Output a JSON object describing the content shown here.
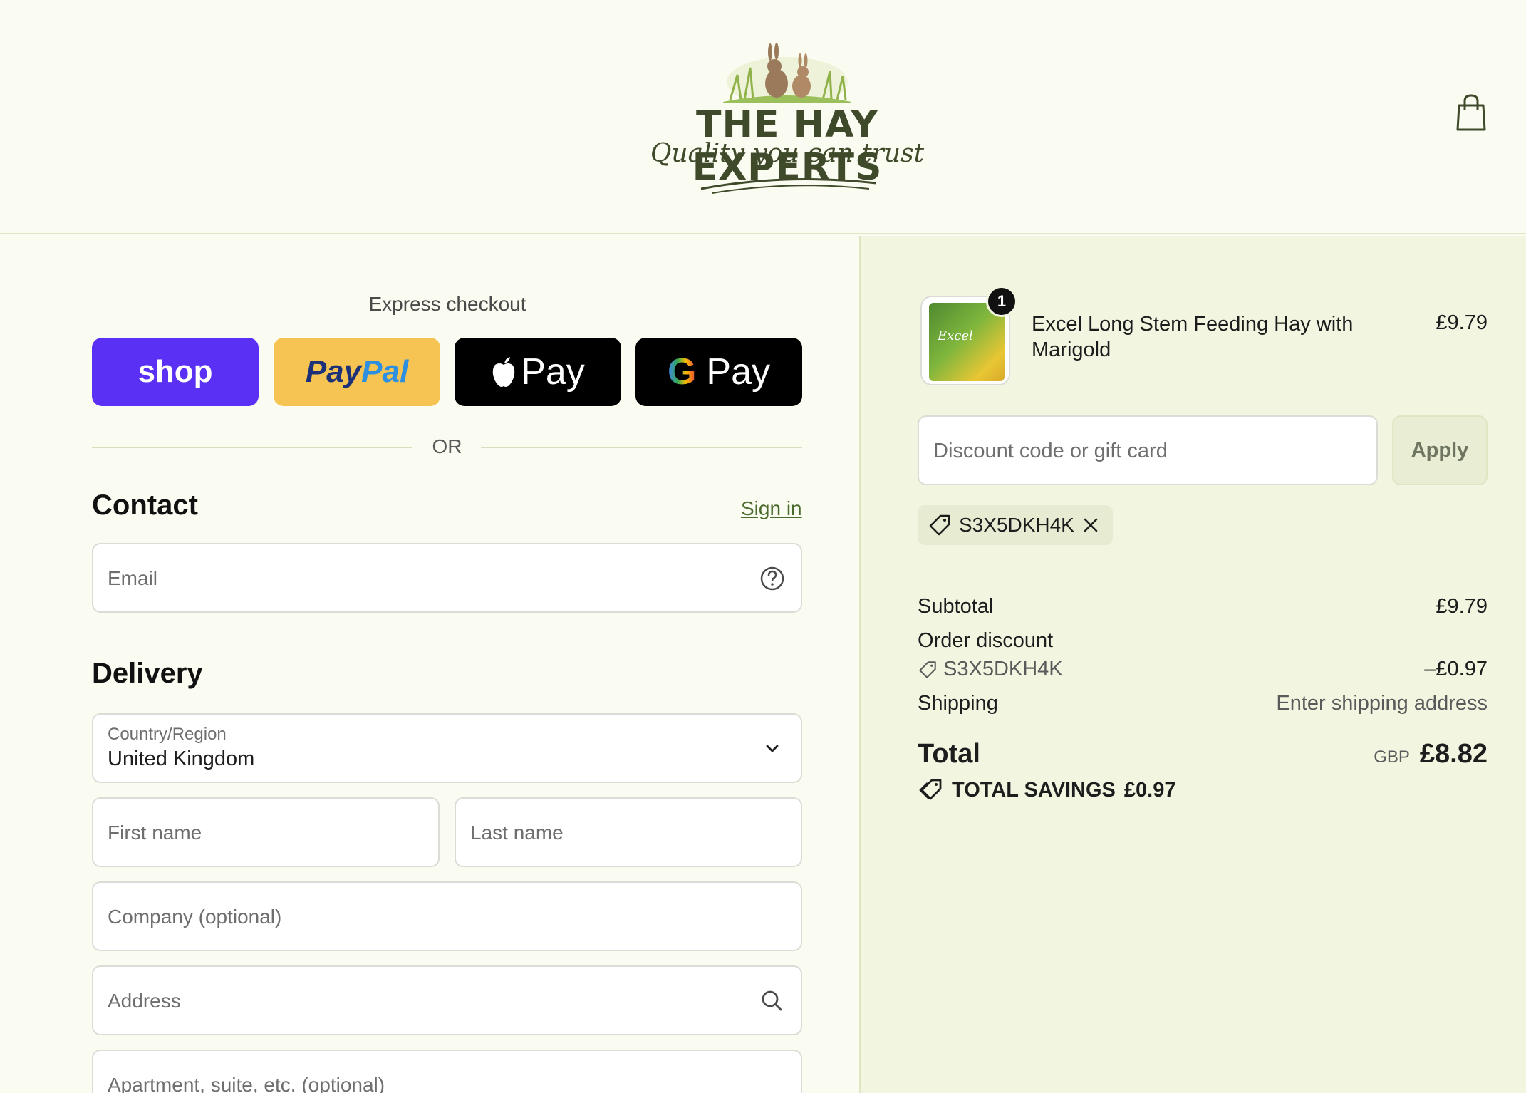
{
  "brand": {
    "name": "THE HAY EXPERTS",
    "tagline": "Quality you can trust"
  },
  "express": {
    "title": "Express checkout",
    "shop_label": "shop",
    "paypal_part1": "Pay",
    "paypal_part2": "Pal",
    "applepay_label": "Pay",
    "gpay_g": "G",
    "gpay_label": "Pay",
    "divider": "OR"
  },
  "contact": {
    "heading": "Contact",
    "signin": "Sign in",
    "email_placeholder": "Email"
  },
  "delivery": {
    "heading": "Delivery",
    "country_label": "Country/Region",
    "country_value": "United Kingdom",
    "first_name": "First name",
    "last_name": "Last name",
    "company": "Company (optional)",
    "address": "Address",
    "apartment": "Apartment, suite, etc. (optional)"
  },
  "order": {
    "product_name": "Excel Long Stem Feeding Hay with Marigold",
    "product_price": "£9.79",
    "product_qty": "1",
    "thumb_text": "Excel",
    "discount_placeholder": "Discount code or gift card",
    "apply_label": "Apply",
    "applied_code": "S3X5DKH4K",
    "subtotal_label": "Subtotal",
    "subtotal_value": "£9.79",
    "order_discount_label": "Order discount",
    "discount_code": "S3X5DKH4K",
    "discount_value": "–£0.97",
    "shipping_label": "Shipping",
    "shipping_value": "Enter shipping address",
    "total_label": "Total",
    "currency": "GBP",
    "total_value": "£8.82",
    "savings_label": "TOTAL SAVINGS",
    "savings_value": "£0.97"
  },
  "colors": {
    "background": "#fbfcf1",
    "sidebar": "#f2f6e1",
    "shop": "#5a31f4",
    "paypal": "#f6c453",
    "brand_text": "#3e4a2a",
    "link": "#4b6b2e"
  }
}
